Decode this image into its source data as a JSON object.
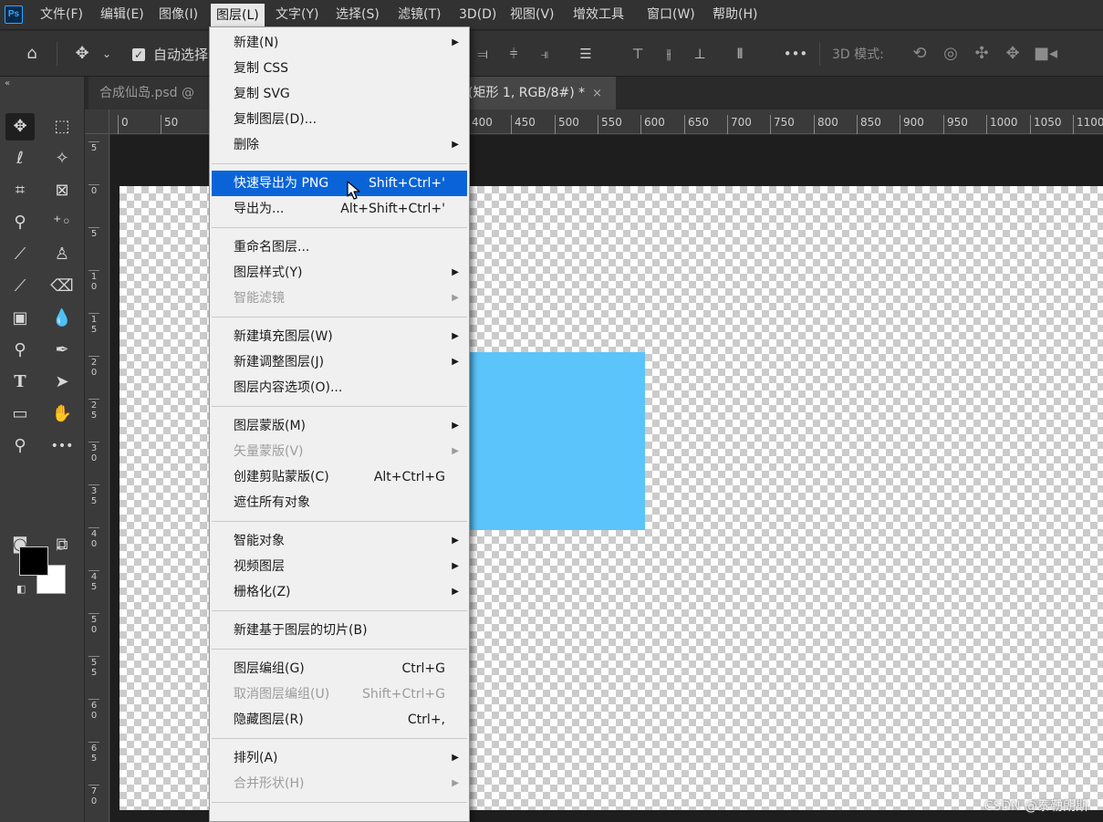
{
  "app": {
    "logo": "Ps"
  },
  "menubar": {
    "items": [
      "文件(F)",
      "编辑(E)",
      "图像(I)",
      "图层(L)",
      "文字(Y)",
      "选择(S)",
      "滤镜(T)",
      "3D(D)",
      "视图(V)",
      "增效工具",
      "窗口(W)",
      "帮助(H)"
    ],
    "active_index": 3
  },
  "options_bar": {
    "auto_select_label": "自动选择",
    "mode3d_label": "3D 模式:",
    "icons": [
      "home-icon",
      "move-icon",
      "align-icons",
      "more-icon",
      "3d-orbit-icons"
    ]
  },
  "tabs": [
    {
      "label": "合成仙岛.psd @",
      "active": false
    },
    {
      "label": "(矩形 1, RGB/8#) *",
      "active": true,
      "close": "×"
    }
  ],
  "ruler_h": [
    "0",
    "50",
    "400",
    "450",
    "500",
    "550",
    "600",
    "650",
    "700",
    "750",
    "800",
    "850",
    "900",
    "950",
    "1000",
    "1050",
    "1100"
  ],
  "ruler_v": [
    "5",
    "0",
    "5",
    "10",
    "15",
    "20",
    "25",
    "30",
    "35",
    "40",
    "45",
    "50",
    "55",
    "60",
    "65",
    "70"
  ],
  "layer_menu": {
    "items": [
      {
        "label": "新建(N)",
        "submenu": true
      },
      {
        "label": "复制 CSS"
      },
      {
        "label": "复制 SVG"
      },
      {
        "label": "复制图层(D)..."
      },
      {
        "label": "删除",
        "submenu": true
      },
      {
        "separator": true
      },
      {
        "label": "快速导出为 PNG",
        "shortcut": "Shift+Ctrl+'",
        "highlighted": true
      },
      {
        "label": "导出为...",
        "shortcut": "Alt+Shift+Ctrl+'"
      },
      {
        "separator": true
      },
      {
        "label": "重命名图层..."
      },
      {
        "label": "图层样式(Y)",
        "submenu": true
      },
      {
        "label": "智能滤镜",
        "submenu": true,
        "disabled": true
      },
      {
        "separator": true
      },
      {
        "label": "新建填充图层(W)",
        "submenu": true
      },
      {
        "label": "新建调整图层(J)",
        "submenu": true
      },
      {
        "label": "图层内容选项(O)..."
      },
      {
        "separator": true
      },
      {
        "label": "图层蒙版(M)",
        "submenu": true
      },
      {
        "label": "矢量蒙版(V)",
        "submenu": true,
        "disabled": true
      },
      {
        "label": "创建剪贴蒙版(C)",
        "shortcut": "Alt+Ctrl+G"
      },
      {
        "label": "遮住所有对象"
      },
      {
        "separator": true
      },
      {
        "label": "智能对象",
        "submenu": true
      },
      {
        "label": "视频图层",
        "submenu": true
      },
      {
        "label": "栅格化(Z)",
        "submenu": true
      },
      {
        "separator": true
      },
      {
        "label": "新建基于图层的切片(B)"
      },
      {
        "separator": true
      },
      {
        "label": "图层编组(G)",
        "shortcut": "Ctrl+G"
      },
      {
        "label": "取消图层编组(U)",
        "shortcut": "Shift+Ctrl+G",
        "disabled": true
      },
      {
        "label": "隐藏图层(R)",
        "shortcut": "Ctrl+,"
      },
      {
        "separator": true
      },
      {
        "label": "排列(A)",
        "submenu": true
      },
      {
        "label": "合并形状(H)",
        "submenu": true,
        "disabled": true
      },
      {
        "separator": true
      }
    ]
  },
  "canvas": {
    "shape_color": "#5bc4fb",
    "highlight_color": "#0a64d8"
  },
  "watermark": "CSDN @泰勒朗斯"
}
